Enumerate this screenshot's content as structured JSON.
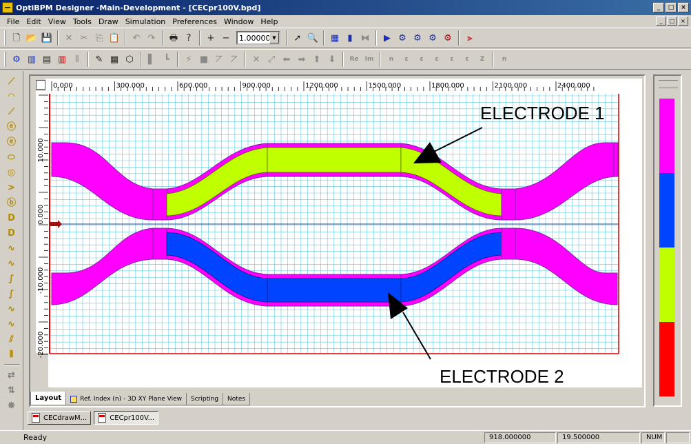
{
  "window": {
    "title": "OptiBPM Designer -Main-Development - [CECpr100V.bpd]",
    "controls": {
      "minimize": "_",
      "restore": "□",
      "close": "×"
    }
  },
  "menu": [
    "File",
    "Edit",
    "View",
    "Tools",
    "Draw",
    "Simulation",
    "Preferences",
    "Window",
    "Help"
  ],
  "toolbar": {
    "zoom_value": "1.00000",
    "row2_labels": [
      "Re",
      "Im"
    ]
  },
  "canvas": {
    "x_ticks": [
      "0.000",
      "300.000",
      "600.000",
      "900.000",
      "1200.000",
      "1500.000",
      "1800.000",
      "2100.000",
      "2400.000"
    ],
    "y_ticks": [
      "10.000",
      "0.000",
      "-10.000",
      "-20.000"
    ],
    "annotations": {
      "electrode1": "ELECTRODE 1",
      "electrode2": "ELECTRODE 2"
    },
    "colors": {
      "waveguide": "#ff00ff",
      "electrode1": "#c0ff00",
      "electrode2": "#0044ff",
      "grid": "#5cc8e0",
      "boundary": "#e00000"
    }
  },
  "tabs": [
    {
      "label": "Layout",
      "active": true
    },
    {
      "label": "Ref. Index (n) - 3D XY Plane View",
      "active": false
    },
    {
      "label": "Scripting",
      "active": false
    },
    {
      "label": "Notes",
      "active": false
    }
  ],
  "documents": [
    {
      "label": "CECdrawM...",
      "active": false
    },
    {
      "label": "CECpr100V...",
      "active": true
    }
  ],
  "colorbar": [
    "#ff00ff",
    "#0044ff",
    "#c0ff00",
    "#ff0000"
  ],
  "status": {
    "ready": "Ready",
    "x": "918.000000",
    "y": "19.500000",
    "num": "NUM"
  }
}
